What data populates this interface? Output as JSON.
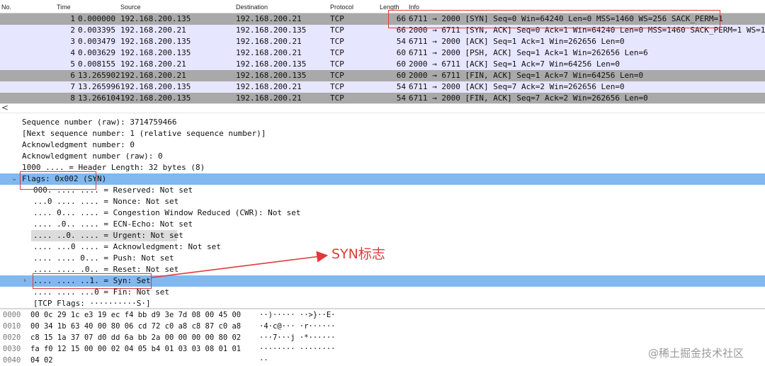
{
  "columns": {
    "no": "No.",
    "time": "Time",
    "source": "Source",
    "destination": "Destination",
    "protocol": "Protocol",
    "length": "Length",
    "info": "Info"
  },
  "packets": [
    {
      "no": "1",
      "time": "0.000000",
      "src": "192.168.200.135",
      "dst": "192.168.200.21",
      "proto": "TCP",
      "len": "66",
      "info": "6711 → 2000 [SYN] Seq=0 Win=64240 Len=0 MSS=1460 WS=256 SACK_PERM=1",
      "style": "selected-gray"
    },
    {
      "no": "2",
      "time": "0.003395",
      "src": "192.168.200.21",
      "dst": "192.168.200.135",
      "proto": "TCP",
      "len": "66",
      "info": "2000 → 6711 [SYN, ACK] Seq=0 Ack=1 Win=64240 Len=0 MSS=1460 SACK_PERM=1 WS=128",
      "style": "lavender"
    },
    {
      "no": "3",
      "time": "0.003479",
      "src": "192.168.200.135",
      "dst": "192.168.200.21",
      "proto": "TCP",
      "len": "54",
      "info": "6711 → 2000 [ACK] Seq=1 Ack=1 Win=262656 Len=0",
      "style": "lavender"
    },
    {
      "no": "4",
      "time": "0.003629",
      "src": "192.168.200.135",
      "dst": "192.168.200.21",
      "proto": "TCP",
      "len": "60",
      "info": "6711 → 2000 [PSH, ACK] Seq=1 Ack=1 Win=262656 Len=6",
      "style": "lavender"
    },
    {
      "no": "5",
      "time": "0.008155",
      "src": "192.168.200.21",
      "dst": "192.168.200.135",
      "proto": "TCP",
      "len": "60",
      "info": "2000 → 6711 [ACK] Seq=1 Ack=7 Win=64256 Len=0",
      "style": "lavender"
    },
    {
      "no": "6",
      "time": "13.265902",
      "src": "192.168.200.21",
      "dst": "192.168.200.135",
      "proto": "TCP",
      "len": "60",
      "info": "2000 → 6711 [FIN, ACK] Seq=1 Ack=7 Win=64256 Len=0",
      "style": "gray"
    },
    {
      "no": "7",
      "time": "13.265996",
      "src": "192.168.200.135",
      "dst": "192.168.200.21",
      "proto": "TCP",
      "len": "54",
      "info": "6711 → 2000 [ACK] Seq=7 Ack=2 Win=262656 Len=0",
      "style": "lavender"
    },
    {
      "no": "8",
      "time": "13.266104",
      "src": "192.168.200.135",
      "dst": "192.168.200.21",
      "proto": "TCP",
      "len": "54",
      "info": "6711 → 2000 [FIN, ACK] Seq=7 Ack=2 Win=262656 Len=0",
      "style": "gray"
    }
  ],
  "scroll_left_icon": "<",
  "details": [
    {
      "text": "Sequence number (raw): 3714759466",
      "indent": 0
    },
    {
      "text": "[Next sequence number: 1    (relative sequence number)]",
      "indent": 0
    },
    {
      "text": "Acknowledgment number: 0",
      "indent": 0
    },
    {
      "text": "Acknowledgment number (raw): 0",
      "indent": 0
    },
    {
      "text": "1000 .... = Header Length: 32 bytes (8)",
      "indent": 0
    },
    {
      "text": "Flags: 0x002 (SYN)",
      "indent": 0,
      "expander": "⌄",
      "highlight": "blue"
    },
    {
      "text": "000. .... .... = Reserved: Not set",
      "indent": 1
    },
    {
      "text": "...0 .... .... = Nonce: Not set",
      "indent": 1
    },
    {
      "text": ".... 0... .... = Congestion Window Reduced (CWR): Not set",
      "indent": 1
    },
    {
      "text": ".... .0.. .... = ECN-Echo: Not set",
      "indent": 1
    },
    {
      "text": ".... ..0. .... = Urgent: Not set",
      "indent": 1,
      "highlight": "gray"
    },
    {
      "text": ".... ...0 .... = Acknowledgment: Not set",
      "indent": 1
    },
    {
      "text": ".... .... 0... = Push: Not set",
      "indent": 1
    },
    {
      "text": ".... .... .0.. = Reset: Not set",
      "indent": 1
    },
    {
      "text": ".... .... ..1. = Syn: Set",
      "indent": 1,
      "expander": "›",
      "highlight": "blue"
    },
    {
      "text": ".... .... ...0 = Fin: Not set",
      "indent": 1
    },
    {
      "text": "[TCP Flags: ··········S·]",
      "indent": 1
    }
  ],
  "bytes": [
    {
      "offset": "0000",
      "hex": "00 0c 29 1c e3 19 ec f4  bb d9 3e 7d 08 00 45 00",
      "ascii": "··)····· ··>}··E·"
    },
    {
      "offset": "0010",
      "hex": "00 34 1b 63 40 00 80 06  cd 72 c0 a8 c8 87 c0 a8",
      "ascii": "·4·c@··· ·r······"
    },
    {
      "offset": "0020",
      "hex": "c8 15 1a 37 07 d0 dd 6a  bb 2a 00 00 00 00 80 02",
      "ascii": "···7···j ·*······"
    },
    {
      "offset": "0030",
      "hex": "fa f0 12 15 00 00 02 04  05 b4 01 03 03 08 01 01",
      "ascii": "········ ········"
    },
    {
      "offset": "0040",
      "hex": "04 02",
      "ascii": "··"
    }
  ],
  "annotation": {
    "label": "SYN标志",
    "color": "#e03a3a"
  },
  "watermark": "@稀土掘金技术社区",
  "colors": {
    "gray_row": "#a9a9a9",
    "lavender_row": "#e7e6ff",
    "blue_highlight": "#80b8ef",
    "gray_highlight": "#dcdcdc",
    "annotation_red": "#e03a3a"
  }
}
